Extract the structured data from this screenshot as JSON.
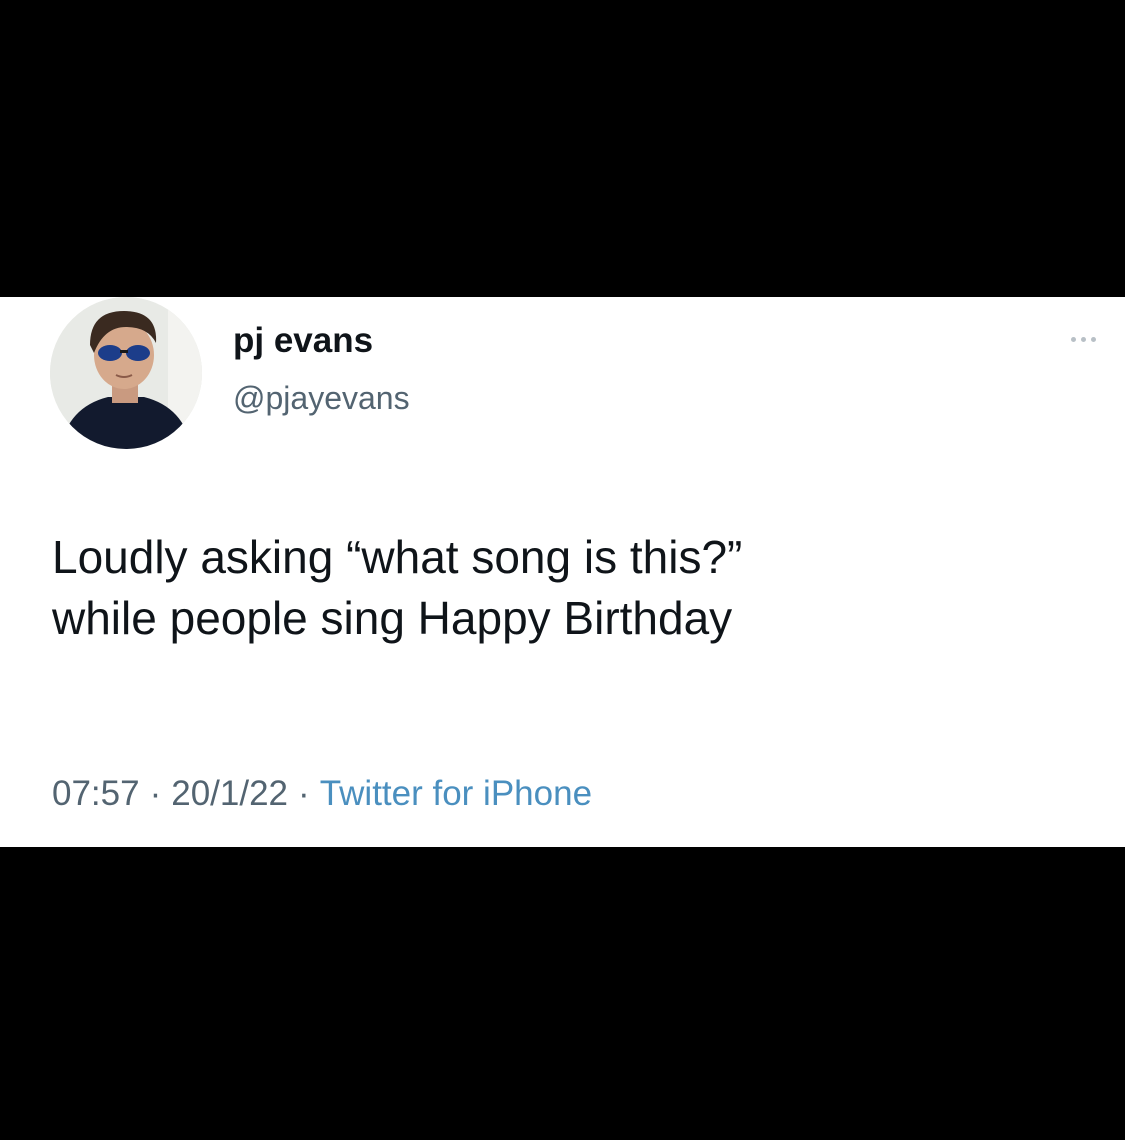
{
  "tweet": {
    "author": {
      "display_name": "pj evans",
      "handle": "@pjayevans",
      "avatar": "profile-photo"
    },
    "text_lines": [
      "Loudly asking “what song is this?”",
      "while people sing Happy Birthday"
    ],
    "time": "07:57",
    "date": "20/1/22",
    "separator": "·",
    "source": "Twitter for iPhone",
    "more_icon": "more-horizontal-icon"
  },
  "colors": {
    "background": "#000000",
    "card": "#ffffff",
    "text": "#0f1419",
    "secondary_text": "#536471",
    "source_link": "#4a8fbf"
  }
}
